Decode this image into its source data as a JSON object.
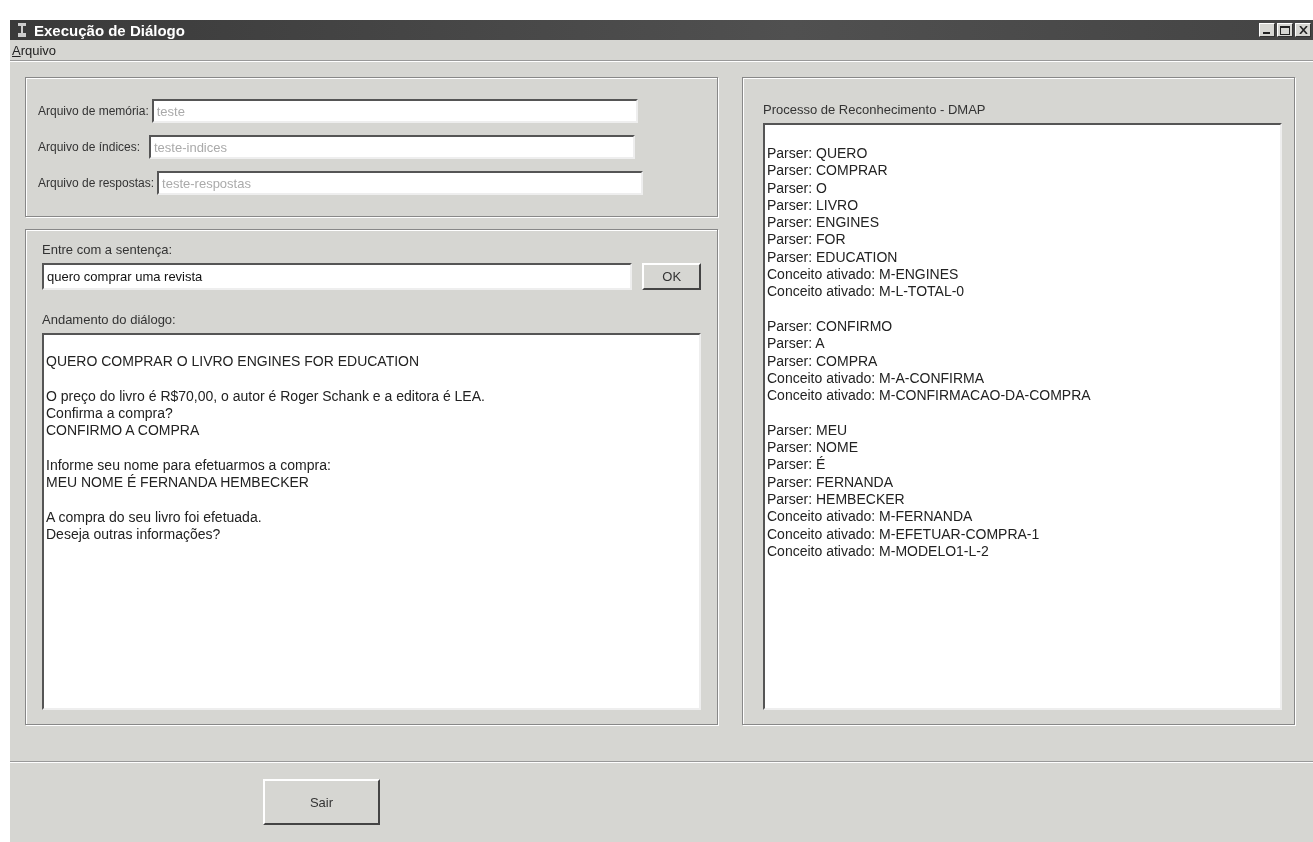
{
  "window": {
    "title": "Execução de Diálogo"
  },
  "menu": [
    {
      "label": "Arquivo"
    }
  ],
  "files": [
    {
      "label": "Arquivo de memória:",
      "value": "teste",
      "disabled": true
    },
    {
      "label": "Arquivo de índices:",
      "value": "teste-indices",
      "disabled": true
    },
    {
      "label": "Arquivo de respostas:",
      "value": "teste-respostas",
      "disabled": true
    }
  ],
  "sentence": {
    "label": "Entre com a sentença:",
    "value": "quero comprar uma revista",
    "button": "OK"
  },
  "dialog": {
    "label": "Andamento do diálogo:",
    "blocks": [
      [
        "QUERO COMPRAR O LIVRO ENGINES FOR EDUCATION"
      ],
      [
        "O preço do livro é  R$70,00, o autor é  Roger Schank e a editora é  LEA.",
        "Confirma a compra?",
        "CONFIRMO A COMPRA"
      ],
      [
        "Informe seu nome para efetuarmos a compra:",
        "MEU NOME É FERNANDA HEMBECKER"
      ],
      [
        "A compra do seu livro foi efetuada.",
        "Deseja outras informações?"
      ]
    ]
  },
  "recognition": {
    "label": "Processo de Reconhecimento - DMAP",
    "blocks": [
      [
        "Parser: QUERO",
        "Parser: COMPRAR",
        "Parser: O",
        "Parser: LIVRO",
        "Parser: ENGINES",
        "Parser: FOR",
        "Parser: EDUCATION",
        "Conceito ativado: M-ENGINES",
        "Conceito ativado: M-L-TOTAL-0"
      ],
      [
        "Parser: CONFIRMO",
        "Parser: A",
        "Parser: COMPRA",
        "Conceito ativado: M-A-CONFIRMA",
        "Conceito ativado: M-CONFIRMACAO-DA-COMPRA"
      ],
      [
        "Parser: MEU",
        "Parser: NOME",
        "Parser: É",
        "Parser: FERNANDA",
        "Parser: HEMBECKER",
        "Conceito ativado: M-FERNANDA",
        "Conceito ativado: M-EFETUAR-COMPRA-1",
        "Conceito ativado: M-MODELO1-L-2"
      ]
    ]
  },
  "buttons": [
    {
      "label": "Sair"
    }
  ]
}
